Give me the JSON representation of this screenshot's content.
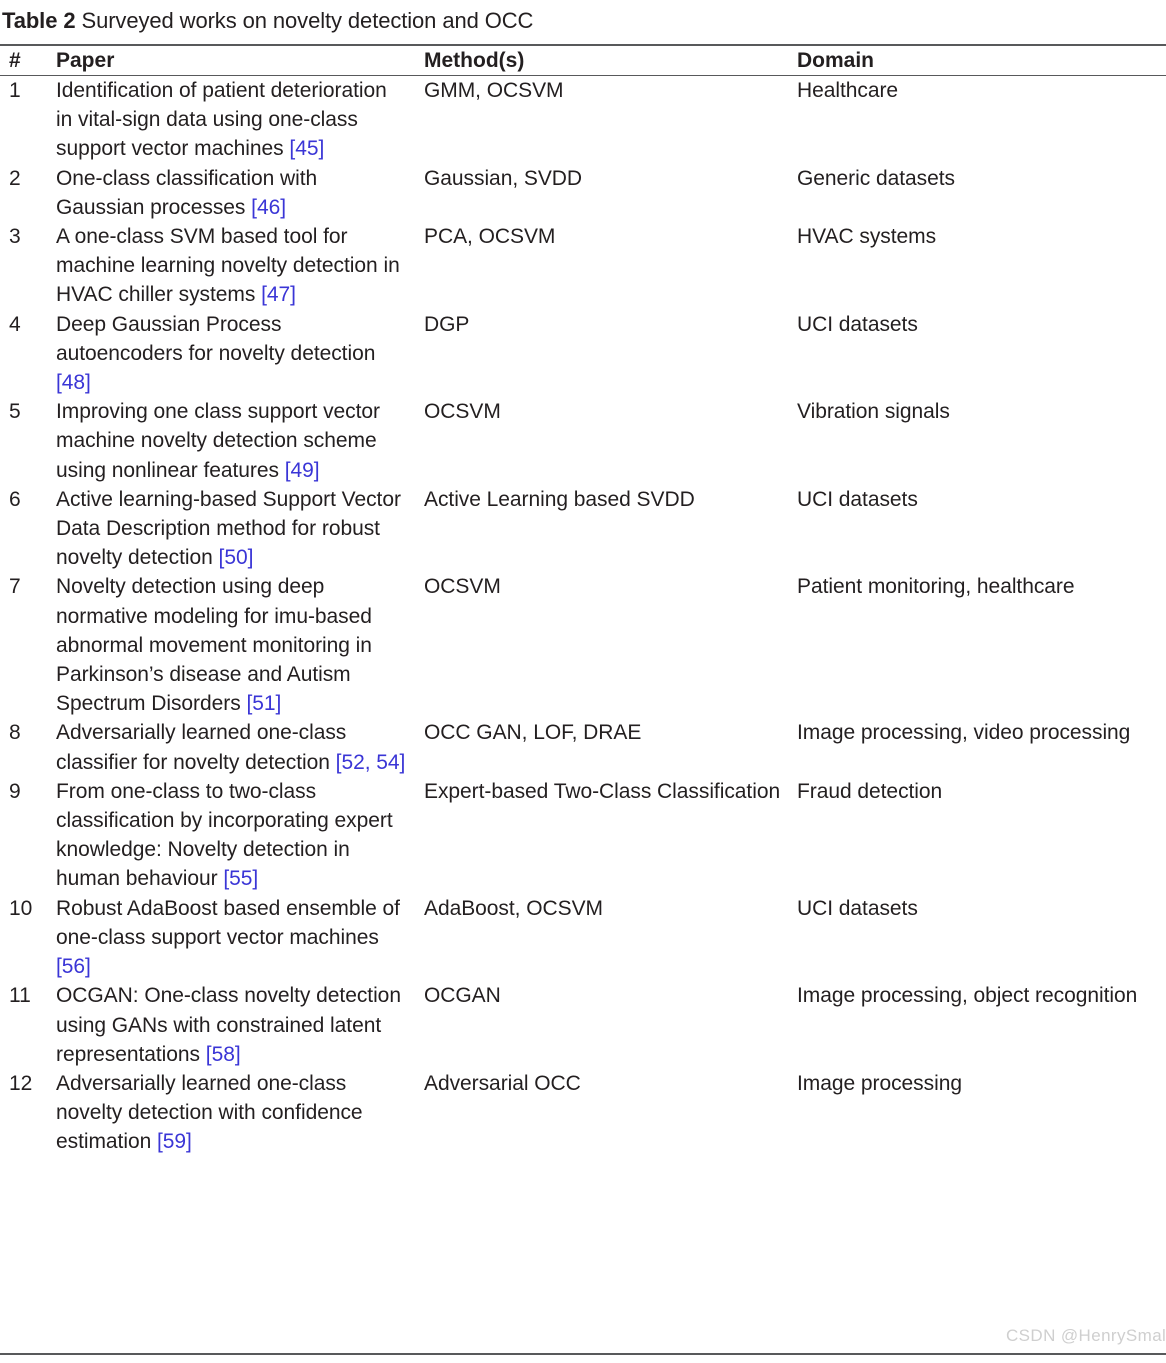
{
  "caption": {
    "label": "Table 2",
    "text": "Surveyed works on novelty detection and OCC"
  },
  "columns": [
    {
      "key": "num",
      "label": "#"
    },
    {
      "key": "paper",
      "label": "Paper"
    },
    {
      "key": "method",
      "label": "Method(s)"
    },
    {
      "key": "domain",
      "label": "Domain"
    }
  ],
  "colors": {
    "text": "#231f20",
    "reference_link": "#3a35d6",
    "rule": "#58595b",
    "watermark": "#cfcfcf"
  },
  "rows": [
    {
      "num": "1",
      "paper": "Identification of patient deterioration in vital-sign data using one-class support vector machines ",
      "paper_ref": "[45]",
      "method": "GMM, OCSVM",
      "domain": "Healthcare"
    },
    {
      "num": "2",
      "paper": "One-class classification with Gaussian processes ",
      "paper_ref": "[46]",
      "method": "Gaussian, SVDD",
      "domain": "Generic datasets"
    },
    {
      "num": "3",
      "paper": "A one-class SVM based tool for machine learning novelty detection in HVAC chiller systems ",
      "paper_ref": "[47]",
      "method": "PCA, OCSVM",
      "domain": "HVAC systems"
    },
    {
      "num": "4",
      "paper": "Deep Gaussian Process autoencoders for novelty detection ",
      "paper_ref": "[48]",
      "method": "DGP",
      "domain": "UCI datasets"
    },
    {
      "num": "5",
      "paper": "Improving one class support vector machine novelty detection scheme using nonlinear features ",
      "paper_ref": "[49]",
      "method": "OCSVM",
      "domain": "Vibration signals"
    },
    {
      "num": "6",
      "paper": "Active learning-based Support Vector Data Description method for robust novelty detection ",
      "paper_ref": "[50]",
      "method": "Active Learning based SVDD",
      "domain": "UCI datasets"
    },
    {
      "num": "7",
      "paper": "Novelty detection using deep normative modeling for imu-based abnormal movement monitoring in Parkinson’s disease and Autism Spectrum Disorders ",
      "paper_ref": "[51]",
      "method": "OCSVM",
      "domain": "Patient monitoring, healthcare"
    },
    {
      "num": "8",
      "paper": "Adversarially learned one-class classifier for novelty detection ",
      "paper_ref": "[52, 54]",
      "method": "OCC GAN, LOF, DRAE",
      "domain": "Image processing, video processing"
    },
    {
      "num": "9",
      "paper": "From one-class to two-class classification by incorporating expert knowledge: Novelty detection in human behaviour ",
      "paper_ref": "[55]",
      "method": "Expert-based Two-Class Classification",
      "domain": "Fraud detection"
    },
    {
      "num": "10",
      "paper": "Robust AdaBoost based ensemble of one-class support vector machines ",
      "paper_ref": "[56]",
      "method": "AdaBoost, OCSVM",
      "domain": "UCI datasets"
    },
    {
      "num": "11",
      "paper": "OCGAN: One-class novelty detection using GANs with constrained latent representations ",
      "paper_ref": "[58]",
      "method": "OCGAN",
      "domain": "Image processing, object recognition"
    },
    {
      "num": "12",
      "paper": "Adversarially learned one-class novelty detection with confidence estimation ",
      "paper_ref": "[59]",
      "method": "Adversarial OCC",
      "domain": "Image processing"
    }
  ],
  "watermark": "CSDN @HenrySmale"
}
